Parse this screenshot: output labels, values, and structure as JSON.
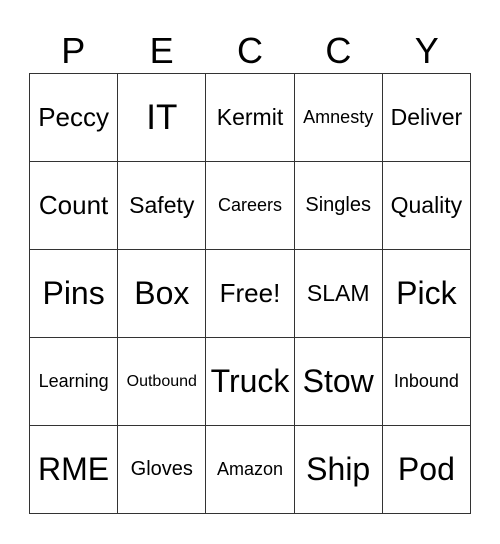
{
  "title_letters": [
    "P",
    "E",
    "C",
    "C",
    "Y"
  ],
  "cells": [
    [
      "Peccy",
      "IT",
      "Kermit",
      "Amnesty",
      "Deliver"
    ],
    [
      "Count",
      "Safety",
      "Careers",
      "Singles",
      "Quality"
    ],
    [
      "Pins",
      "Box",
      "Free!",
      "SLAM",
      "Pick"
    ],
    [
      "Learning",
      "Outbound",
      "Truck",
      "Stow",
      "Inbound"
    ],
    [
      "RME",
      "Gloves",
      "Amazon",
      "Ship",
      "Pod"
    ]
  ]
}
